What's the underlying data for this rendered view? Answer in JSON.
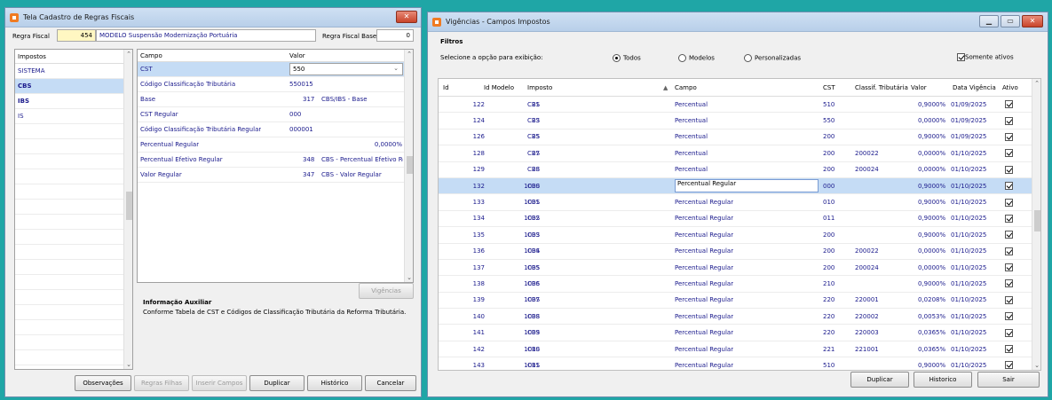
{
  "left_window": {
    "title": "Tela Cadastro de Regras Fiscais",
    "regra_fiscal_label": "Regra Fiscal",
    "regra_fiscal_id": "454",
    "regra_fiscal_desc": "MODELO Suspensão Modernização Portuária",
    "regra_fiscal_base_label": "Regra Fiscal Base",
    "regra_fiscal_base_value": "0",
    "impostos_header": "Impostos",
    "impostos": [
      "SISTEMA",
      "CBS",
      "IBS",
      "IS"
    ],
    "selected_imposto": "CBS",
    "campo_header": "Campo",
    "valor_header": "Valor",
    "rows": [
      {
        "campo": "CST",
        "valor": "550",
        "extra": ""
      },
      {
        "campo": "Código Classificação Tributária",
        "valor": "550015",
        "extra": ""
      },
      {
        "campo": "Base",
        "valor": "317",
        "extra": "CBS/IBS - Base"
      },
      {
        "campo": "CST Regular",
        "valor": "000",
        "extra": ""
      },
      {
        "campo": "Código Classificação Tributária Regular",
        "valor": "000001",
        "extra": ""
      },
      {
        "campo": "Percentual Regular",
        "valor": "0,0000%",
        "extra": ""
      },
      {
        "campo": "Percentual Efetivo Regular",
        "valor": "348",
        "extra": "CBS - Percentual Efetivo Reg"
      },
      {
        "campo": "Valor Regular",
        "valor": "347",
        "extra": "CBS - Valor Regular"
      }
    ],
    "vigencias_button": "Vigências",
    "info_title": "Informação Auxiliar",
    "info_text": "Conforme Tabela de CST e Códigos de Classificação Tributária da Reforma Tributária.",
    "buttons": {
      "observacoes": "Observações",
      "regras_filhas": "Regras Filhas",
      "inserir_campos": "Inserir Campos",
      "duplicar": "Duplicar",
      "historico": "Histórico",
      "cancelar": "Cancelar"
    }
  },
  "right_window": {
    "title": "Vigências - Campos Impostos",
    "filtros_label": "Filtros",
    "selecione_label": "Selecione a opção para exibição:",
    "radio_todos": "Todos",
    "radio_modelos": "Modelos",
    "radio_personalizadas": "Personalizadas",
    "somente_ativos": "Somente ativos",
    "columns": {
      "id": "Id",
      "id_modelo": "Id Modelo",
      "imposto": "Imposto",
      "campo": "Campo",
      "cst": "CST",
      "classif": "Classif. Tributária",
      "valor": "Valor",
      "data_vigencia": "Data Vigência",
      "ativo": "Ativo"
    },
    "rows": [
      {
        "id": "122",
        "id_modelo": "21",
        "imposto": "CBS",
        "campo": "Percentual",
        "cst": "510",
        "classif": "",
        "valor": "0,9000%",
        "data": "01/09/2025"
      },
      {
        "id": "124",
        "id_modelo": "23",
        "imposto": "CBS",
        "campo": "Percentual",
        "cst": "550",
        "classif": "",
        "valor": "0,0000%",
        "data": "01/09/2025"
      },
      {
        "id": "126",
        "id_modelo": "25",
        "imposto": "CBS",
        "campo": "Percentual",
        "cst": "200",
        "classif": "",
        "valor": "0,9000%",
        "data": "01/09/2025"
      },
      {
        "id": "128",
        "id_modelo": "27",
        "imposto": "CBS",
        "campo": "Percentual",
        "cst": "200",
        "classif": "200022",
        "valor": "0,0000%",
        "data": "01/10/2025"
      },
      {
        "id": "129",
        "id_modelo": "28",
        "imposto": "CBS",
        "campo": "Percentual",
        "cst": "200",
        "classif": "200024",
        "valor": "0,0000%",
        "data": "01/10/2025"
      },
      {
        "id": "132",
        "id_modelo": "1000",
        "imposto": "CBS",
        "campo": "Percentual Regular",
        "cst": "000",
        "classif": "",
        "valor": "0,9000%",
        "data": "01/10/2025"
      },
      {
        "id": "133",
        "id_modelo": "1001",
        "imposto": "CBS",
        "campo": "Percentual Regular",
        "cst": "010",
        "classif": "",
        "valor": "0,9000%",
        "data": "01/10/2025"
      },
      {
        "id": "134",
        "id_modelo": "1002",
        "imposto": "CBS",
        "campo": "Percentual Regular",
        "cst": "011",
        "classif": "",
        "valor": "0,9000%",
        "data": "01/10/2025"
      },
      {
        "id": "135",
        "id_modelo": "1003",
        "imposto": "CBS",
        "campo": "Percentual Regular",
        "cst": "200",
        "classif": "",
        "valor": "0,9000%",
        "data": "01/10/2025"
      },
      {
        "id": "136",
        "id_modelo": "1004",
        "imposto": "CBS",
        "campo": "Percentual Regular",
        "cst": "200",
        "classif": "200022",
        "valor": "0,0000%",
        "data": "01/10/2025"
      },
      {
        "id": "137",
        "id_modelo": "1005",
        "imposto": "CBS",
        "campo": "Percentual Regular",
        "cst": "200",
        "classif": "200024",
        "valor": "0,0000%",
        "data": "01/10/2025"
      },
      {
        "id": "138",
        "id_modelo": "1006",
        "imposto": "CBS",
        "campo": "Percentual Regular",
        "cst": "210",
        "classif": "",
        "valor": "0,9000%",
        "data": "01/10/2025"
      },
      {
        "id": "139",
        "id_modelo": "1007",
        "imposto": "CBS",
        "campo": "Percentual Regular",
        "cst": "220",
        "classif": "220001",
        "valor": "0,0208%",
        "data": "01/10/2025"
      },
      {
        "id": "140",
        "id_modelo": "1008",
        "imposto": "CBS",
        "campo": "Percentual Regular",
        "cst": "220",
        "classif": "220002",
        "valor": "0,0053%",
        "data": "01/10/2025"
      },
      {
        "id": "141",
        "id_modelo": "1009",
        "imposto": "CBS",
        "campo": "Percentual Regular",
        "cst": "220",
        "classif": "220003",
        "valor": "0,0365%",
        "data": "01/10/2025"
      },
      {
        "id": "142",
        "id_modelo": "1010",
        "imposto": "CBS",
        "campo": "Percentual Regular",
        "cst": "221",
        "classif": "221001",
        "valor": "0,0365%",
        "data": "01/10/2025"
      },
      {
        "id": "143",
        "id_modelo": "1011",
        "imposto": "CBS",
        "campo": "Percentual Regular",
        "cst": "510",
        "classif": "",
        "valor": "0,9000%",
        "data": "01/10/2025"
      }
    ],
    "buttons": {
      "duplicar": "Duplicar",
      "historico": "Historico",
      "sair": "Sair"
    }
  },
  "colors": {
    "desktop": "#1fa6a6",
    "selection": "#c5dcf5",
    "link_text": "#1a1a8c",
    "close_button": "#c9442a"
  }
}
